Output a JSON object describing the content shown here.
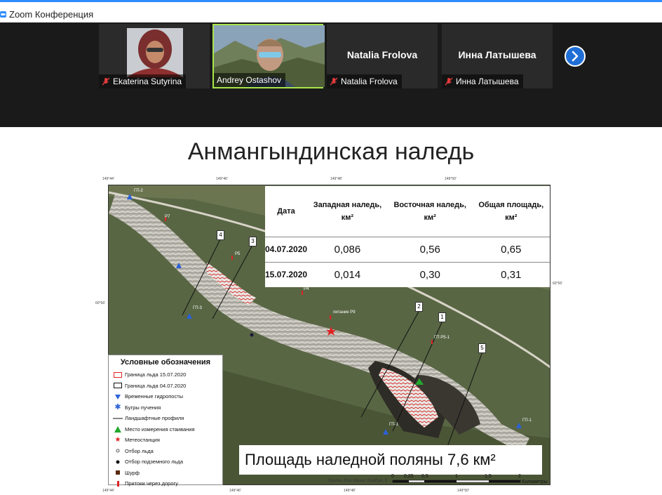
{
  "window": {
    "title": "Zoom Конференция"
  },
  "participants": [
    {
      "name": "Ekaterina Sutyrina",
      "video": true,
      "muted": true,
      "active": false
    },
    {
      "name": "Andrey Ostashov",
      "video": true,
      "muted": false,
      "active": true
    },
    {
      "name": "Natalia Frolova",
      "video": false,
      "muted": true,
      "active": false,
      "display_name": "Natalia Frolova"
    },
    {
      "name": "Инна Латышева",
      "video": false,
      "muted": true,
      "active": false,
      "display_name": "Инна Латышева"
    }
  ],
  "slide": {
    "title": "Анмангындинская наледь",
    "table": {
      "headers": [
        "Дата",
        "Западная наледь, км²",
        "Восточная наледь, км²",
        "Общая площадь, км²"
      ],
      "rows": [
        [
          "04.07.2020",
          "0,086",
          "0,56",
          "0,65"
        ],
        [
          "15.07.2020",
          "0,014",
          "0,30",
          "0,31"
        ]
      ]
    },
    "legend": {
      "title": "Условные обозначения",
      "items": [
        {
          "label": "Граница льда 15.07.2020",
          "symbol": "red-rect"
        },
        {
          "label": "Граница льда 04.07.2020",
          "symbol": "black-rect"
        },
        {
          "label": "Временные гидропосты",
          "symbol": "blue-triangle"
        },
        {
          "label": "Бугры пучения",
          "symbol": "blue-asterisk"
        },
        {
          "label": "Ландшафтные профиля",
          "symbol": "line"
        },
        {
          "label": "Место измерения стаивания",
          "symbol": "green-triangle"
        },
        {
          "label": "Метеостанция",
          "symbol": "red-star"
        },
        {
          "label": "Отбор льда",
          "symbol": "small-circle"
        },
        {
          "label": "Отбор подземного льда",
          "symbol": "black-dot"
        },
        {
          "label": "Шурф",
          "symbol": "brown-square"
        },
        {
          "label": "Притоки через дорогу",
          "symbol": "red-bar"
        }
      ]
    },
    "area_caption": "Площадь наледной поляны 7,6 км²",
    "source": "Source: Esri, Maxar, GeoEye, E",
    "scale": {
      "ticks": [
        "0",
        "0,25",
        "0,5",
        "1",
        "1,5",
        "2"
      ],
      "unit": "Километры"
    },
    "coords_top": [
      "149°44'",
      "149°46'",
      "149°48'",
      "149°50'"
    ],
    "coords_bottom": [
      "149°44'",
      "149°46'",
      "149°48'",
      "149°50'"
    ],
    "coord_left": "60°56'",
    "coord_right": "60°56'",
    "profile_labels": [
      "4",
      "3",
      "2",
      "1",
      "5"
    ],
    "map_labels": [
      "ГП-2",
      "Р7",
      "Р5",
      "Р4",
      "ГП-3",
      "питание Р9",
      "ГП Р5-1",
      "ГП-1",
      "ГП-1"
    ]
  },
  "colors": {
    "accent": "#2d8cff",
    "active_border": "#a8e64a",
    "next_button": "#1f6fd6"
  }
}
